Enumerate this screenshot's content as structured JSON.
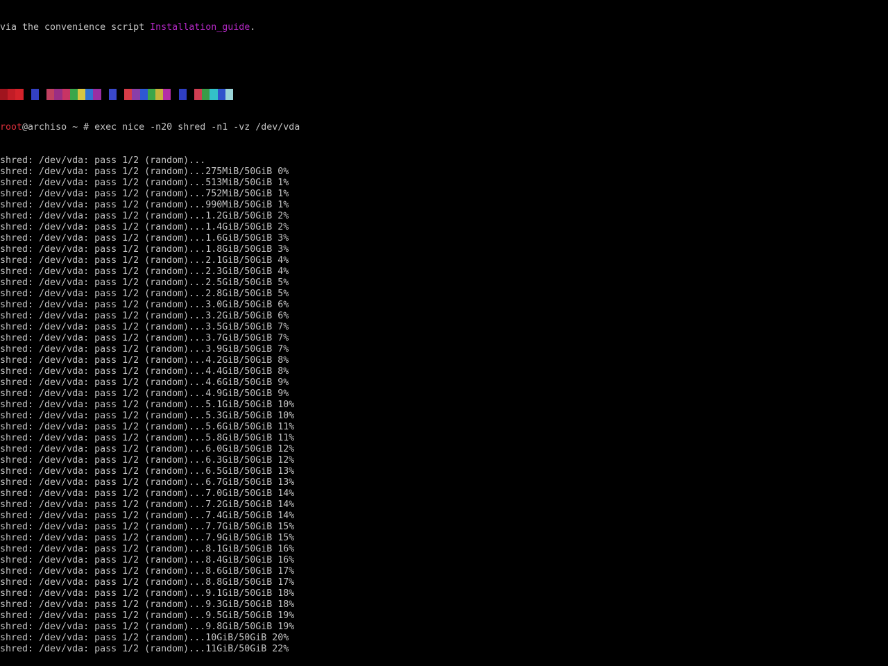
{
  "header": {
    "intro_text": "via the convenience script ",
    "link_text": "Installation_guide",
    "trailing_text": "."
  },
  "color_bar": {
    "colors": [
      "#a0141e",
      "#c21c26",
      "#d4222a",
      "#000000",
      "#3340c4",
      "#000000",
      "#c04060",
      "#9a2e84",
      "#c83464",
      "#3aa64a",
      "#d8c640",
      "#3272d2",
      "#9a2ea2",
      "#000000",
      "#3a48cc",
      "#000000",
      "#d83c48",
      "#8a3ea8",
      "#2e58d4",
      "#3aa64a",
      "#c6b43c",
      "#b42ea6",
      "#000000",
      "#2e3ec4",
      "#000000",
      "#d03e52",
      "#3a9c48",
      "#33c0c8",
      "#2f52cc",
      "#9ad4d8"
    ]
  },
  "prompt": {
    "user": "root",
    "host_part": "@archiso",
    "rest": " ~ # exec nice -n20 shred -n1 -vz /dev/vda"
  },
  "output_lines": [
    "shred: /dev/vda: pass 1/2 (random)...",
    "shred: /dev/vda: pass 1/2 (random)...275MiB/50GiB 0%",
    "shred: /dev/vda: pass 1/2 (random)...513MiB/50GiB 1%",
    "shred: /dev/vda: pass 1/2 (random)...752MiB/50GiB 1%",
    "shred: /dev/vda: pass 1/2 (random)...990MiB/50GiB 1%",
    "shred: /dev/vda: pass 1/2 (random)...1.2GiB/50GiB 2%",
    "shred: /dev/vda: pass 1/2 (random)...1.4GiB/50GiB 2%",
    "shred: /dev/vda: pass 1/2 (random)...1.6GiB/50GiB 3%",
    "shred: /dev/vda: pass 1/2 (random)...1.8GiB/50GiB 3%",
    "shred: /dev/vda: pass 1/2 (random)...2.1GiB/50GiB 4%",
    "shred: /dev/vda: pass 1/2 (random)...2.3GiB/50GiB 4%",
    "shred: /dev/vda: pass 1/2 (random)...2.5GiB/50GiB 5%",
    "shred: /dev/vda: pass 1/2 (random)...2.8GiB/50GiB 5%",
    "shred: /dev/vda: pass 1/2 (random)...3.0GiB/50GiB 6%",
    "shred: /dev/vda: pass 1/2 (random)...3.2GiB/50GiB 6%",
    "shred: /dev/vda: pass 1/2 (random)...3.5GiB/50GiB 7%",
    "shred: /dev/vda: pass 1/2 (random)...3.7GiB/50GiB 7%",
    "shred: /dev/vda: pass 1/2 (random)...3.9GiB/50GiB 7%",
    "shred: /dev/vda: pass 1/2 (random)...4.2GiB/50GiB 8%",
    "shred: /dev/vda: pass 1/2 (random)...4.4GiB/50GiB 8%",
    "shred: /dev/vda: pass 1/2 (random)...4.6GiB/50GiB 9%",
    "shred: /dev/vda: pass 1/2 (random)...4.9GiB/50GiB 9%",
    "shred: /dev/vda: pass 1/2 (random)...5.1GiB/50GiB 10%",
    "shred: /dev/vda: pass 1/2 (random)...5.3GiB/50GiB 10%",
    "shred: /dev/vda: pass 1/2 (random)...5.6GiB/50GiB 11%",
    "shred: /dev/vda: pass 1/2 (random)...5.8GiB/50GiB 11%",
    "shred: /dev/vda: pass 1/2 (random)...6.0GiB/50GiB 12%",
    "shred: /dev/vda: pass 1/2 (random)...6.3GiB/50GiB 12%",
    "shred: /dev/vda: pass 1/2 (random)...6.5GiB/50GiB 13%",
    "shred: /dev/vda: pass 1/2 (random)...6.7GiB/50GiB 13%",
    "shred: /dev/vda: pass 1/2 (random)...7.0GiB/50GiB 14%",
    "shred: /dev/vda: pass 1/2 (random)...7.2GiB/50GiB 14%",
    "shred: /dev/vda: pass 1/2 (random)...7.4GiB/50GiB 14%",
    "shred: /dev/vda: pass 1/2 (random)...7.7GiB/50GiB 15%",
    "shred: /dev/vda: pass 1/2 (random)...7.9GiB/50GiB 15%",
    "shred: /dev/vda: pass 1/2 (random)...8.1GiB/50GiB 16%",
    "shred: /dev/vda: pass 1/2 (random)...8.4GiB/50GiB 16%",
    "shred: /dev/vda: pass 1/2 (random)...8.6GiB/50GiB 17%",
    "shred: /dev/vda: pass 1/2 (random)...8.8GiB/50GiB 17%",
    "shred: /dev/vda: pass 1/2 (random)...9.1GiB/50GiB 18%",
    "shred: /dev/vda: pass 1/2 (random)...9.3GiB/50GiB 18%",
    "shred: /dev/vda: pass 1/2 (random)...9.5GiB/50GiB 19%",
    "shred: /dev/vda: pass 1/2 (random)...9.8GiB/50GiB 19%",
    "shred: /dev/vda: pass 1/2 (random)...10GiB/50GiB 20%",
    "shred: /dev/vda: pass 1/2 (random)...11GiB/50GiB 22%"
  ],
  "colors": {
    "background": "#000000",
    "text": "#c4c4c4",
    "link": "#b328c4",
    "prompt_user": "#e0303c"
  }
}
